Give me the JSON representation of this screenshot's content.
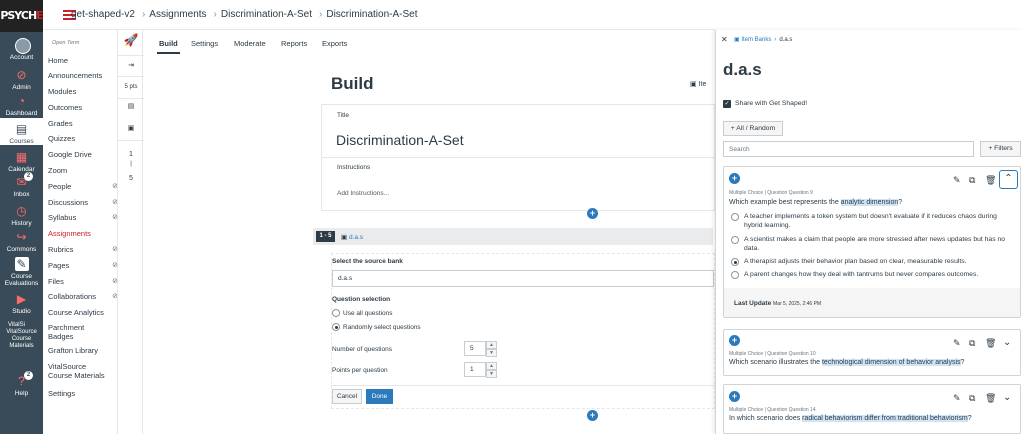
{
  "colors": {
    "brand": "#c7212b",
    "nav_bg": "#394b58",
    "primary": "#2b7abc",
    "highlight": "#cfe5f7"
  },
  "logo": {
    "text_main": "PSYCH",
    "text_accent": "E"
  },
  "global_nav": [
    {
      "label": "Account",
      "icon": "avatar-icon"
    },
    {
      "label": "Admin",
      "icon": "admin-icon"
    },
    {
      "label": "Dashboard",
      "icon": "dashboard-icon"
    },
    {
      "label": "Courses",
      "icon": "courses-icon"
    },
    {
      "label": "Calendar",
      "icon": "calendar-icon"
    },
    {
      "label": "Inbox",
      "icon": "inbox-icon",
      "badge": "2"
    },
    {
      "label": "History",
      "icon": "history-icon"
    },
    {
      "label": "Commons",
      "icon": "commons-icon"
    },
    {
      "label": "Course Evaluations",
      "icon": "course-evaluations-icon"
    },
    {
      "label": "Studio",
      "icon": "studio-icon"
    },
    {
      "label": "VitalSource Course Materials",
      "icon": "vitalsource-icon",
      "img_label": "VitalSi"
    },
    {
      "label": "Help",
      "icon": "help-icon",
      "badge": "2"
    }
  ],
  "breadcrumbs": [
    "get-shaped-v2",
    "Assignments",
    "Discrimination-A-Set",
    "Discrimination-A-Set"
  ],
  "course_nav": {
    "term": "Open Term",
    "items": [
      {
        "label": "Home"
      },
      {
        "label": "Announcements"
      },
      {
        "label": "Modules"
      },
      {
        "label": "Outcomes"
      },
      {
        "label": "Grades"
      },
      {
        "label": "Quizzes"
      },
      {
        "label": "Google Drive"
      },
      {
        "label": "Zoom"
      },
      {
        "label": "People",
        "hidden": true
      },
      {
        "label": "Discussions",
        "hidden": true
      },
      {
        "label": "Syllabus",
        "hidden": true
      },
      {
        "label": "Assignments",
        "active": true
      },
      {
        "label": "Rubrics",
        "hidden": true
      },
      {
        "label": "Pages",
        "hidden": true
      },
      {
        "label": "Files",
        "hidden": true
      },
      {
        "label": "Collaborations",
        "hidden": true
      },
      {
        "label": "Course Analytics"
      },
      {
        "label": "Parchment Badges"
      },
      {
        "label": "Grafton Library"
      },
      {
        "label": "VitalSource Course Materials"
      },
      {
        "label": "Settings"
      }
    ]
  },
  "tool_strip": {
    "points": "5 pts",
    "range_start": "1",
    "range_end": "5"
  },
  "tabs": [
    "Build",
    "Settings",
    "Moderate",
    "Reports",
    "Exports"
  ],
  "build": {
    "heading": "Build",
    "item_bank_btn": "Ite",
    "title_label": "Title",
    "title_value": "Discrimination-A-Set",
    "instructions_label": "Instructions",
    "instructions_placeholder": "Add Instructions...",
    "range_badge": "1 - 5",
    "bank_link": "d.a.s",
    "source_bank_label": "Select the source bank",
    "source_bank_value": "d.a.s",
    "question_selection_label": "Question selection",
    "option_all": "Use all questions",
    "option_random": "Randomly select questions",
    "num_questions_label": "Number of questions",
    "num_questions_value": "5",
    "points_label": "Points per question",
    "points_value": "1",
    "cancel": "Cancel",
    "done": "Done"
  },
  "tray": {
    "breadcrumb_root": "Item Banks",
    "breadcrumb_current": "d.a.s",
    "title": "d.a.s",
    "share_label": "Share with Get Shaped!",
    "all_random_btn": "All / Random",
    "search_placeholder": "Search",
    "filters_btn": "Filters",
    "q1": {
      "meta": "Multiple Choice | Question Question 9",
      "prompt_pre": "Which example best represents the ",
      "prompt_hl": "analytic dimension",
      "prompt_post": "?",
      "options": [
        "A teacher implements a token system but doesn't evaluate if it reduces chaos during hybrid learning.",
        "A scientist makes a claim that people are more stressed after news updates but has no data.",
        "A therapist adjusts their behavior plan based on clear, measurable results.",
        "A parent changes how they deal with tantrums but never compares outcomes."
      ],
      "last_update_label": "Last Update",
      "last_update_value": "Mar 5, 2025, 2:46 PM"
    },
    "q2": {
      "meta": "Multiple Choice | Question Question 10",
      "prompt_pre": "Which scenario illustrates the ",
      "prompt_hl": "technological dimension of behavior analysis",
      "prompt_post": "?"
    },
    "q3": {
      "meta": "Multiple Choice | Question Question 14",
      "prompt_pre": "In which scenario does ",
      "prompt_hl": "radical behaviorism differ from traditional behaviorism",
      "prompt_post": "?"
    }
  }
}
